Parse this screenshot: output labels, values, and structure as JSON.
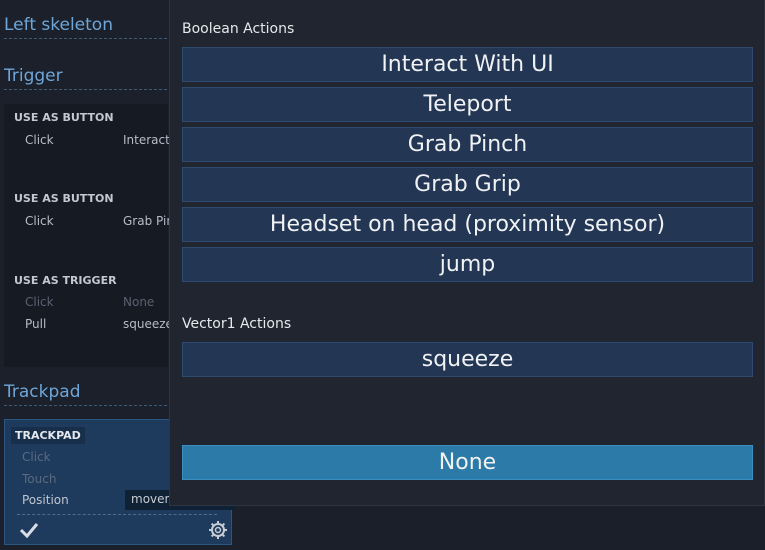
{
  "left_panel": {
    "title_left_skeleton": "Left skeleton",
    "trigger": {
      "title": "Trigger",
      "groups": [
        {
          "header": "USE AS BUTTON",
          "rows": [
            {
              "label": "Click",
              "value": "Interact W"
            }
          ]
        },
        {
          "header": "USE AS BUTTON",
          "rows": [
            {
              "label": "Click",
              "value": "Grab Pinc"
            }
          ]
        },
        {
          "header": "USE AS TRIGGER",
          "rows": [
            {
              "label": "Click",
              "value": "None"
            },
            {
              "label": "Pull",
              "value": "squeeze"
            }
          ]
        }
      ]
    },
    "trackpad": {
      "title": "Trackpad",
      "header": "TRACKPAD",
      "rows": [
        {
          "label": "Click"
        },
        {
          "label": "Touch"
        },
        {
          "label": "Position",
          "value": "movem"
        }
      ],
      "confirm_icon": "check-icon",
      "settings_icon": "gear-icon"
    }
  },
  "popup": {
    "boolean_header": "Boolean Actions",
    "boolean_actions": [
      "Interact With UI",
      "Teleport",
      "Grab Pinch",
      "Grab Grip",
      "Headset on head (proximity sensor)",
      "jump"
    ],
    "vector1_header": "Vector1 Actions",
    "vector1_actions": [
      "squeeze"
    ],
    "none_option": "None"
  },
  "colors": {
    "accent_title": "#6fa6d8",
    "selected_option": "#2b7aa7",
    "option_bg": "#233654"
  }
}
